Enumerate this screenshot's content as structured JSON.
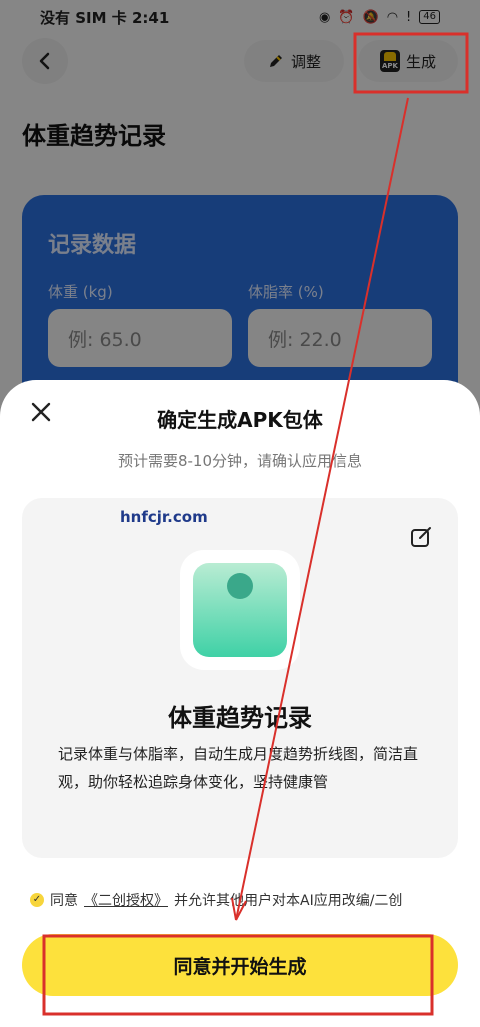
{
  "status_bar": {
    "left": "没有 SIM 卡 2:41",
    "battery": "46"
  },
  "nav": {
    "back_icon": "chevron-left-icon",
    "adjust_label": "调整",
    "generate_label": "生成",
    "apk_icon_text": "APK"
  },
  "page": {
    "title": "体重趋势记录",
    "record_card": {
      "title": "记录数据",
      "weight_label": "体重 (kg)",
      "weight_placeholder": "例: 65.0",
      "bodyfat_label": "体脂率 (%)",
      "bodyfat_placeholder": "例: 22.0"
    }
  },
  "sheet": {
    "title": "确定生成APK包体",
    "subtitle": "预计需要8-10分钟，请确认应用信息",
    "watermark": "hnfcjr.com",
    "app_name": "体重趋势记录",
    "app_description": "记录体重与体脂率，自动生成月度趋势折线图，简洁直观，助你轻松追踪身体变化，坚持健康管",
    "agree_prefix": "同意",
    "agree_link": "《二创授权》",
    "agree_suffix": "并允许其他用户对本AI应用改编/二创",
    "primary_button": "同意并开始生成"
  },
  "colors": {
    "accent_yellow": "#fde13c",
    "card_blue": "#2b6fdc",
    "annotation_red": "#d9302b"
  }
}
